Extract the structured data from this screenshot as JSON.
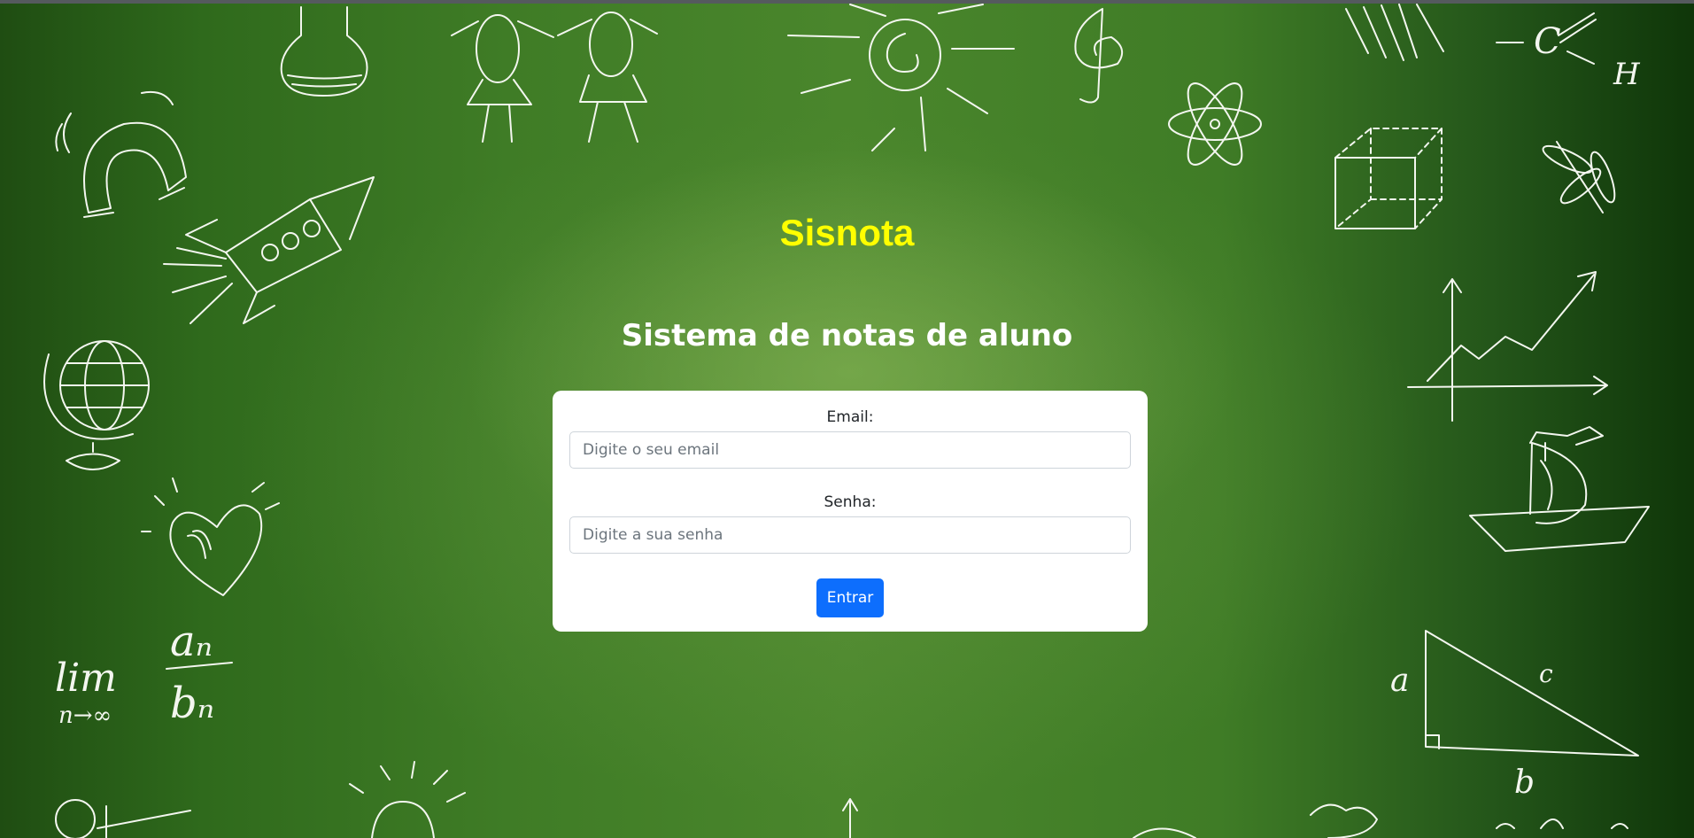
{
  "header": {
    "title": "Sisnota",
    "subtitle": "Sistema de notas de aluno"
  },
  "login_form": {
    "email_label": "Email:",
    "email_placeholder": "Digite o seu email",
    "email_value": "",
    "password_label": "Senha:",
    "password_placeholder": "Digite a sua senha",
    "password_value": "",
    "submit_label": "Entrar"
  },
  "background": {
    "chalk_text": {
      "lim": "lim",
      "lim_sub": "n→∞",
      "numerator": "aₙ",
      "denominator": "bₙ",
      "chem_c": "C",
      "chem_h": "H",
      "tri_a": "a",
      "tri_b": "b",
      "tri_c": "c"
    }
  },
  "colors": {
    "title": "#ffff00",
    "button": "#0d6efd",
    "board_green": "#3f7c26"
  }
}
